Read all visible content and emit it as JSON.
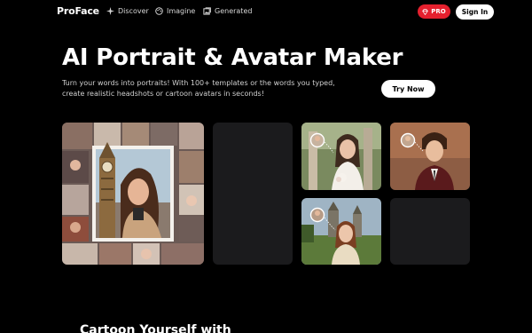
{
  "header": {
    "logo": "ProFace",
    "nav": [
      {
        "label": "Discover",
        "icon": "sparkle-icon"
      },
      {
        "label": "Imagine",
        "icon": "palette-icon"
      },
      {
        "label": "Generated",
        "icon": "gallery-icon"
      }
    ],
    "pro_label": "PRO",
    "signin_label": "Sign In"
  },
  "hero": {
    "title": "AI Portrait & Avatar Maker",
    "subtitle": "Turn your words into portraits! With 100+ templates or the words you typed, create realistic headshots or cartoon avatars in seconds!",
    "cta_label": "Try Now"
  },
  "gallery": [
    {
      "name": "collage-portrait-big-ben"
    },
    {
      "name": "empty-card"
    },
    {
      "name": "bride-portrait"
    },
    {
      "name": "suit-man-portrait"
    },
    {
      "name": "castle-portrait"
    },
    {
      "name": "empty-card"
    }
  ],
  "section": {
    "title": "Cartoon Yourself with"
  },
  "colors": {
    "pro_red": "#e5202e",
    "background": "#000000",
    "card_bg": "#1b1b1d"
  }
}
